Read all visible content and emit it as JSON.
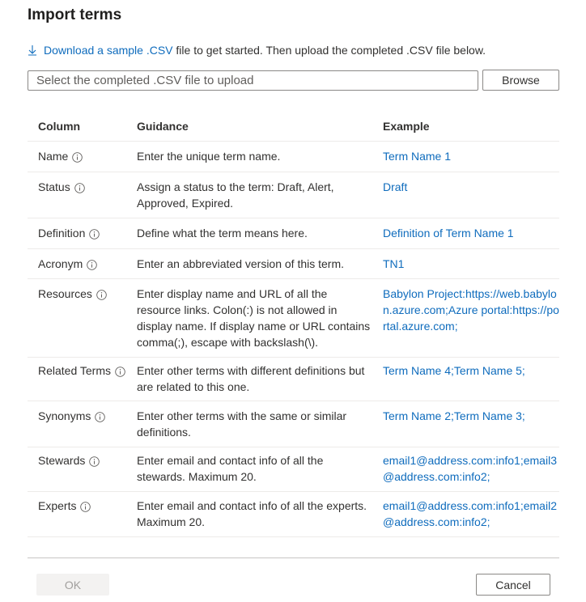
{
  "dialog": {
    "title": "Import terms",
    "download_link": "Download a sample .CSV",
    "download_text": " file to get started. Then upload the completed .CSV file below.",
    "file_placeholder": "Select the completed .CSV file to upload",
    "browse_label": "Browse",
    "ok_label": "OK",
    "cancel_label": "Cancel"
  },
  "table": {
    "headers": [
      "Column",
      "Guidance",
      "Example"
    ],
    "rows": [
      {
        "column": "Name",
        "guidance": "Enter the unique term name.",
        "example": "Term Name 1"
      },
      {
        "column": "Status",
        "guidance": "Assign a status to the term: Draft, Alert, Approved, Expired.",
        "example": "Draft"
      },
      {
        "column": "Definition",
        "guidance": "Define what the term means here.",
        "example": "Definition of Term Name 1"
      },
      {
        "column": "Acronym",
        "guidance": "Enter an abbreviated version of this term.",
        "example": "TN1"
      },
      {
        "column": "Resources",
        "guidance": "Enter display name and URL of all the resource links. Colon(:) is not allowed in display name. If display name or URL contains comma(;), escape with backslash(\\).",
        "example": "Babylon Project:https://web.babylon.azure.com;Azure portal:https://portal.azure.com;"
      },
      {
        "column": "Related Terms",
        "guidance": "Enter other terms with different definitions but are related to this one.",
        "example": "Term Name 4;Term Name 5;"
      },
      {
        "column": "Synonyms",
        "guidance": "Enter other terms with the same or similar definitions.",
        "example": "Term Name 2;Term Name 3;"
      },
      {
        "column": "Stewards",
        "guidance": "Enter email and contact info of all the stewards. Maximum 20.",
        "example": "email1@address.com:info1;email3@address.com:info2;"
      },
      {
        "column": "Experts",
        "guidance": "Enter email and contact info of all the experts. Maximum 20.",
        "example": "email1@address.com:info1;email2@address.com:info2;"
      }
    ]
  },
  "colors": {
    "link": "#0f6cbd",
    "text": "#323130",
    "border": "#edebe9"
  }
}
